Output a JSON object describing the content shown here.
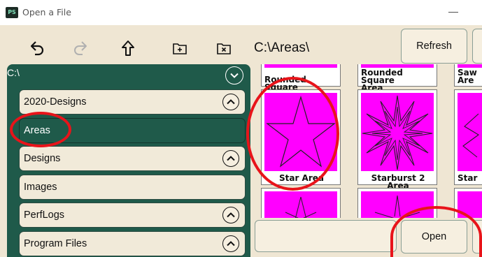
{
  "window": {
    "title": "Open a File",
    "app_icon_text": "PS",
    "minimize_glyph": "—"
  },
  "toolbar": {
    "back_icon": "back-icon",
    "forward_icon": "forward-icon",
    "up_icon": "up-arrow-icon",
    "new_folder_icon": "new-folder-icon",
    "delete_folder_icon": "delete-folder-icon",
    "path": "C:\\Areas\\",
    "refresh_label": "Refresh"
  },
  "tree": {
    "root_label": "C:\\",
    "items": [
      {
        "label": "2020-Designs",
        "expandable": true
      },
      {
        "label": "Areas",
        "selected": true
      },
      {
        "label": "Designs",
        "expandable": true
      },
      {
        "label": "Images"
      },
      {
        "label": "PerfLogs",
        "expandable": true
      },
      {
        "label": "Program Files",
        "expandable": true
      }
    ]
  },
  "thumbnails": [
    {
      "label": "Rounded Square"
    },
    {
      "label": "Rounded Square\nArea"
    },
    {
      "label": "Saw\nAre"
    },
    {
      "label": "Star Area"
    },
    {
      "label": "Starburst 2 Area"
    },
    {
      "label": "Star"
    }
  ],
  "footer": {
    "filename_value": "",
    "open_label": "Open"
  },
  "colors": {
    "panel_green": "#1f5a4a",
    "background_beige": "#efe6d3",
    "thumbnail_magenta": "#ff00ff",
    "annotation_red": "#e8141a"
  }
}
